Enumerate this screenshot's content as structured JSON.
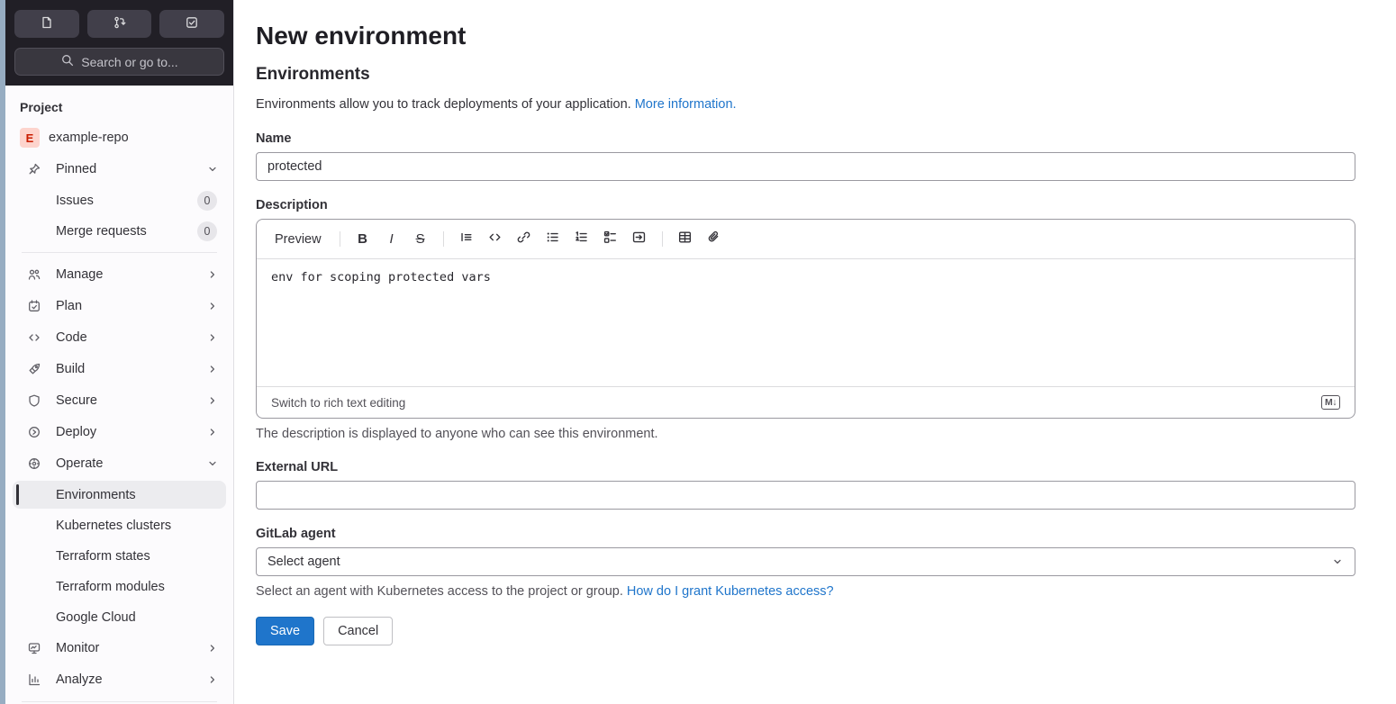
{
  "colors": {
    "accent_blue": "#1f75cb",
    "save_button_bg": "#1f75cb",
    "active_item_indicator": "#333238",
    "active_item_bg": "#ececef",
    "sidebar_header_bg": "#211f26",
    "avatar_bg": "#fdd4cd",
    "avatar_text": "#c91c00"
  },
  "sidebar": {
    "search_label": "Search or go to...",
    "section_label": "Project",
    "project": {
      "avatar_letter": "E",
      "name": "example-repo"
    },
    "pinned": {
      "label": "Pinned",
      "items": [
        {
          "label": "Issues",
          "badge": "0"
        },
        {
          "label": "Merge requests",
          "badge": "0"
        }
      ]
    },
    "nav": [
      {
        "label": "Manage"
      },
      {
        "label": "Plan"
      },
      {
        "label": "Code"
      },
      {
        "label": "Build"
      },
      {
        "label": "Secure"
      },
      {
        "label": "Deploy"
      },
      {
        "label": "Operate"
      }
    ],
    "operate_children": [
      {
        "label": "Environments",
        "active": true
      },
      {
        "label": "Kubernetes clusters"
      },
      {
        "label": "Terraform states"
      },
      {
        "label": "Terraform modules"
      },
      {
        "label": "Google Cloud"
      }
    ],
    "nav_bottom": [
      {
        "label": "Monitor"
      },
      {
        "label": "Analyze"
      }
    ]
  },
  "main": {
    "title": "New environment",
    "section_title": "Environments",
    "intro_text": "Environments allow you to track deployments of your application.",
    "intro_link": "More information.",
    "name_field": {
      "label": "Name",
      "value": "protected"
    },
    "description_field": {
      "label": "Description",
      "toolbar": {
        "preview_label": "Preview",
        "bold_glyph": "B",
        "italic_glyph": "I",
        "strike_glyph": "S"
      },
      "value": "env for scoping protected vars",
      "footer_link": "Switch to rich text editing",
      "markdown_badge": "M↓",
      "help": "The description is displayed to anyone who can see this environment."
    },
    "external_url_field": {
      "label": "External URL",
      "value": ""
    },
    "agent_field": {
      "label": "GitLab agent",
      "selected": "Select agent",
      "help_text": "Select an agent with Kubernetes access to the project or group.",
      "help_link": "How do I grant Kubernetes access?"
    },
    "actions": {
      "save": "Save",
      "cancel": "Cancel"
    }
  }
}
